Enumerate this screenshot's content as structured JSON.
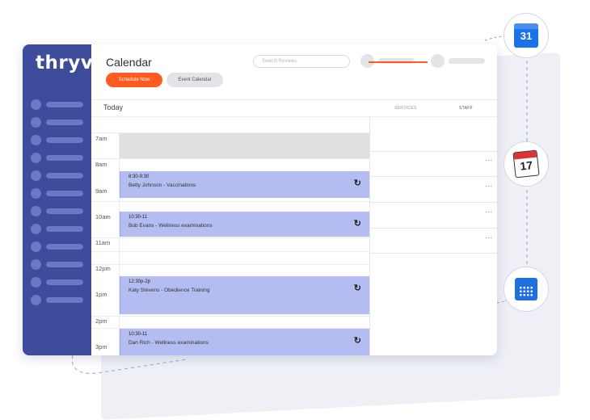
{
  "logo": "thryv",
  "header": {
    "title": "Calendar",
    "schedule_button": "Schedule Now",
    "event_button": "Event Calendar",
    "search_placeholder": "Search Reviews"
  },
  "subbar": {
    "today": "Today",
    "tabs": [
      "SERVICES",
      "STAFF"
    ]
  },
  "times": [
    "7am",
    "8am",
    "9am",
    "10am",
    "11am",
    "12pm",
    "1pm",
    "2pm",
    "3pm"
  ],
  "events": [
    {
      "time": "8:30-9:30",
      "desc": "Betty Johnson - Vaccinations"
    },
    {
      "time": "10:30-11",
      "desc": "Bob Evans - Wellness examinations"
    },
    {
      "time": "12:30p-2p",
      "desc": "Katy Stevens - Obedience Training"
    },
    {
      "time": "10:30-11",
      "desc": "Dan Rich - Wellness examinations"
    }
  ],
  "floating_icons": {
    "google_calendar_day": "31",
    "page_calendar_day": "17"
  },
  "colors": {
    "sidebar": "#3e4c9c",
    "accent": "#ff5a1f",
    "event": "#b3bdf2"
  }
}
